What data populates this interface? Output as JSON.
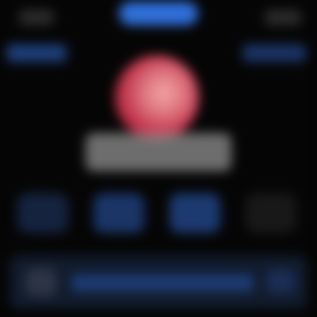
{
  "screen": {
    "background": "#050505",
    "accent": "#2f6fd8",
    "avatar_color": "#c0304a"
  },
  "status_bar": {
    "left": "",
    "center_pill": "",
    "right": ""
  },
  "nav": {
    "left_label": "",
    "right_label": ""
  },
  "contact": {
    "name": ""
  },
  "actions": [
    {
      "icon": "message-icon",
      "label": ""
    },
    {
      "icon": "call-icon",
      "label": ""
    },
    {
      "icon": "video-icon",
      "label": ""
    },
    {
      "icon": "mail-icon",
      "label": ""
    }
  ],
  "card": {
    "text": ""
  }
}
